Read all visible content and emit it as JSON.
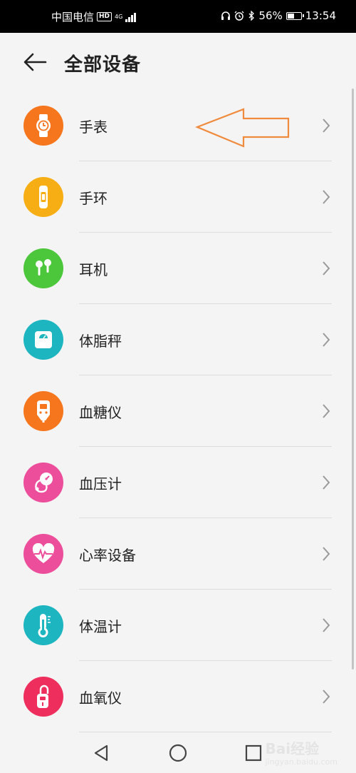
{
  "status_bar": {
    "carrier": "中国电信",
    "hd": "HD",
    "network": "4G",
    "battery": "56%",
    "battery_level": 0.56,
    "time": "13:54"
  },
  "header": {
    "title": "全部设备"
  },
  "devices": [
    {
      "label": "手表",
      "icon": "watch-icon",
      "color": "#f6761d"
    },
    {
      "label": "手环",
      "icon": "band-icon",
      "color": "#f6ae14"
    },
    {
      "label": "耳机",
      "icon": "earphones-icon",
      "color": "#4cc63a"
    },
    {
      "label": "体脂秤",
      "icon": "scale-icon",
      "color": "#1cb5c0"
    },
    {
      "label": "血糖仪",
      "icon": "glucose-meter-icon",
      "color": "#f6761d"
    },
    {
      "label": "血压计",
      "icon": "blood-pressure-icon",
      "color": "#ec4e9b"
    },
    {
      "label": "心率设备",
      "icon": "heart-rate-icon",
      "color": "#ec4e9b"
    },
    {
      "label": "体温计",
      "icon": "thermometer-icon",
      "color": "#1cb5c0"
    },
    {
      "label": "血氧仪",
      "icon": "oximeter-icon",
      "color": "#ee2f5e"
    }
  ],
  "annotation_arrow_color": "#f08a3c",
  "watermark": {
    "text": "Bai经验",
    "sub": "jingyan.baidu.com"
  }
}
